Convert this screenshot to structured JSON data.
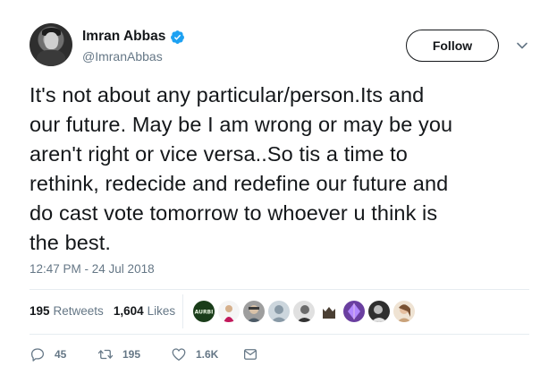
{
  "author": {
    "display_name": "Imran Abbas",
    "handle": "@ImranAbbas",
    "verified": true,
    "avatar": "profile-photo"
  },
  "follow_button": {
    "label": "Follow"
  },
  "menu": {
    "icon": "chevron-down-icon"
  },
  "tweet": {
    "text_lines": [
      "It's not about any particular/person.Its and",
      "our future. May be I am wrong or may be you",
      "aren't right or vice versa..So tis a time to",
      "rethink, redecide and redefine our future and",
      "do cast vote tomorrow to whoever u think is",
      "the best."
    ],
    "timestamp": "12:47 PM - 24 Jul 2018"
  },
  "stats": {
    "retweets_count": "195",
    "retweets_label": "Retweets",
    "likes_count": "1,604",
    "likes_label": "Likes"
  },
  "likers": [
    {
      "label": "AURBI",
      "color": "#1a3d1a"
    },
    {
      "color": "#c2185b"
    },
    {
      "color": "#8a8a8a"
    },
    {
      "color": "#aab8c2"
    },
    {
      "color": "#6b6b6b"
    },
    {
      "color": "#5b4a3a"
    },
    {
      "color": "#6a3fa0"
    },
    {
      "color": "#4a4a4a"
    },
    {
      "color": "#c9a27a"
    }
  ],
  "actions": {
    "reply_count": "45",
    "retweet_count": "195",
    "like_count": "1.6K",
    "icons": [
      "reply-icon",
      "retweet-icon",
      "heart-icon",
      "message-icon"
    ]
  },
  "colors": {
    "text": "#14171a",
    "secondary": "#657786",
    "verified_blue": "#1da1f2",
    "divider": "#e6ecf0"
  }
}
